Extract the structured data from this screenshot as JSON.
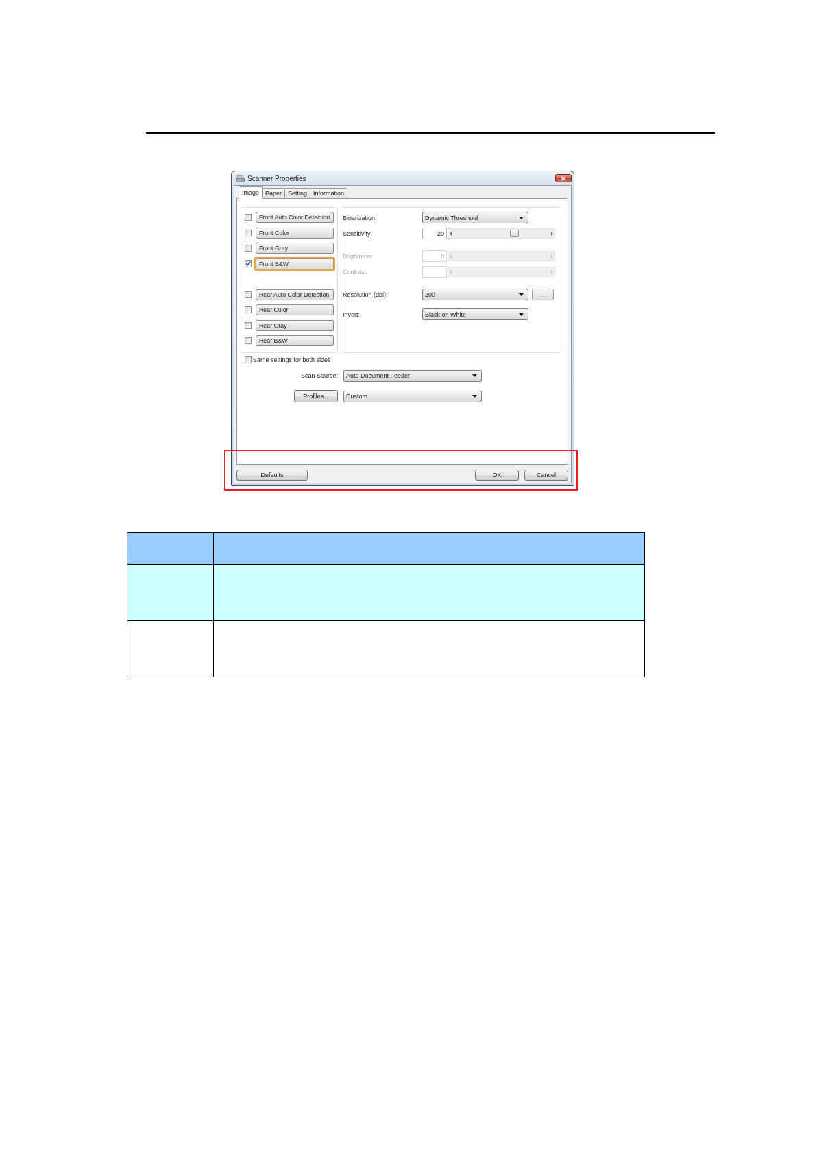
{
  "window": {
    "title": "Scanner Properties"
  },
  "tabs": [
    {
      "label": "Image",
      "selected": true
    },
    {
      "label": "Paper",
      "selected": false
    },
    {
      "label": "Setting",
      "selected": false
    },
    {
      "label": "Information",
      "selected": false
    }
  ],
  "image_type_groups": [
    {
      "items": [
        {
          "label": "Front Auto Color Detection",
          "checked": false,
          "selected": false
        },
        {
          "label": "Front Color",
          "checked": false,
          "selected": false
        },
        {
          "label": "Front Gray",
          "checked": false,
          "selected": false
        },
        {
          "label": "Front B&W",
          "checked": true,
          "selected": true
        }
      ]
    },
    {
      "items": [
        {
          "label": "Rear Auto Color Detection",
          "checked": false,
          "selected": false
        },
        {
          "label": "Rear Color",
          "checked": false,
          "selected": false
        },
        {
          "label": "Rear Gray",
          "checked": false,
          "selected": false
        },
        {
          "label": "Rear B&W",
          "checked": false,
          "selected": false
        }
      ]
    }
  ],
  "settings": [
    {
      "kind": "dropdown",
      "label": "Binarization:",
      "value": "Dynamic Threshold",
      "disabled": false
    },
    {
      "kind": "slider",
      "label": "Sensitivity:",
      "value": "20",
      "level": 0.65,
      "disabled": false
    },
    {
      "kind": "slider",
      "label": "Brightness",
      "value": "0",
      "disabled": true
    },
    {
      "kind": "slider",
      "label": "Contrast:",
      "disabled": true
    },
    {
      "kind": "dropdown",
      "label": "Resolution (dpi):",
      "value": "200",
      "disabled": false,
      "button": {
        "label": "...",
        "disabled": true
      }
    },
    {
      "kind": "dropdown",
      "label": "Invert:",
      "value": "Black on White",
      "disabled": false
    }
  ],
  "same_settings": {
    "label": "Same settings for both sides",
    "checked": false
  },
  "scan_source": {
    "label": "Scan Source:",
    "value": "Auto Document Feeder"
  },
  "profiles": {
    "button": "Profiles...",
    "value": "Custom"
  },
  "button_bar": {
    "highlighted": true,
    "left_buttons": [
      "Defaults"
    ],
    "right_buttons": [
      "OK",
      "Cancel"
    ]
  },
  "table": {
    "rows": [
      {
        "color": "#99ccff"
      },
      {
        "color": "#ccffff"
      },
      {
        "color": "#ffffff"
      }
    ]
  }
}
